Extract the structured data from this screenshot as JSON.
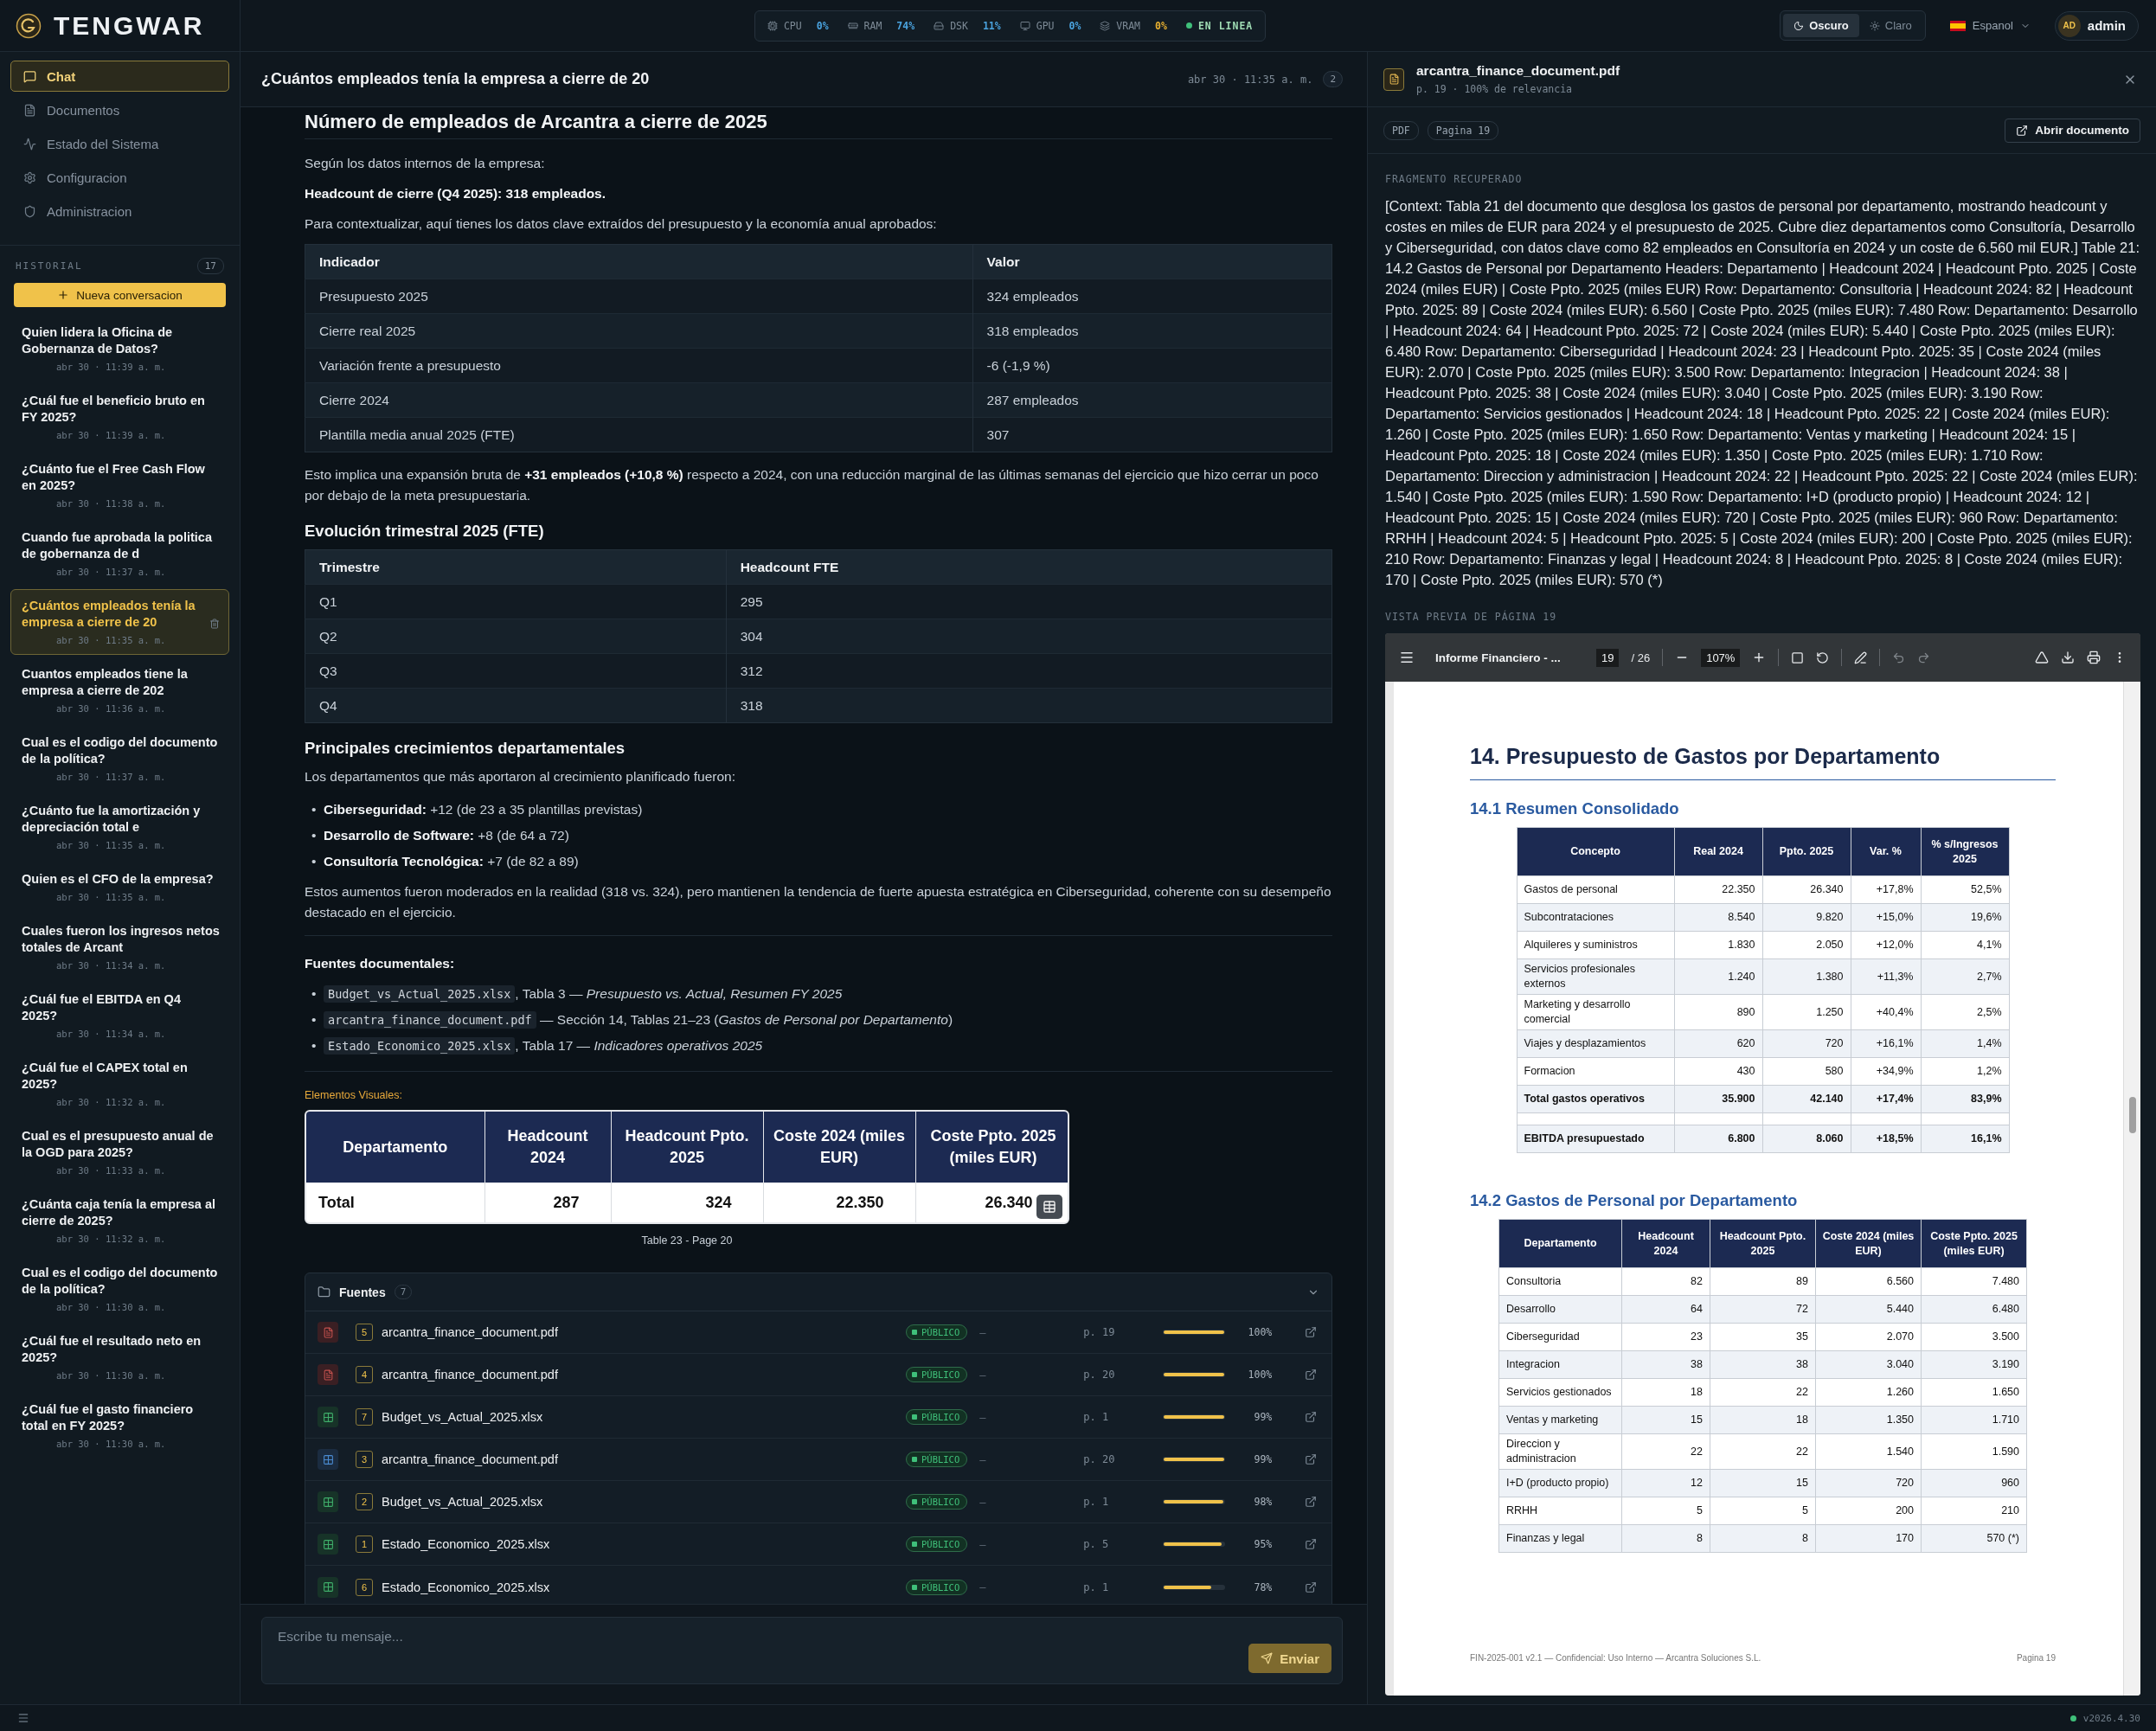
{
  "app": {
    "name": "TENGWAR"
  },
  "system_status": {
    "metrics": [
      {
        "kind": "cpu",
        "label": "CPU",
        "value": "0%",
        "color": "#4aa3df"
      },
      {
        "kind": "ram",
        "label": "RAM",
        "value": "74%",
        "color": "#4aa3df"
      },
      {
        "kind": "disk",
        "label": "DSK",
        "value": "11%",
        "color": "#4aa3df"
      },
      {
        "kind": "gpu",
        "label": "GPU",
        "value": "0%",
        "color": "#4aa3df"
      },
      {
        "kind": "vram",
        "label": "VRAM",
        "value": "0%",
        "color": "#e8b030"
      }
    ],
    "status": "EN LINEA"
  },
  "header_controls": {
    "themes": [
      {
        "kind": "dark",
        "label": "Oscuro",
        "selected": true
      },
      {
        "kind": "light",
        "label": "Claro",
        "selected": false
      }
    ],
    "language": "Espanol",
    "user": {
      "initials": "AD",
      "name": "admin"
    }
  },
  "sidebar": {
    "nav": [
      {
        "kind": "chat",
        "label": "Chat",
        "selected": true
      },
      {
        "kind": "docs",
        "label": "Documentos",
        "selected": false
      },
      {
        "kind": "status",
        "label": "Estado del Sistema",
        "selected": false
      },
      {
        "kind": "config",
        "label": "Configuracion",
        "selected": false
      },
      {
        "kind": "admin",
        "label": "Administracion",
        "selected": false
      }
    ],
    "history_label": "HISTORIAL",
    "history_count": "17",
    "new_button": "Nueva conversacion",
    "history": [
      {
        "title": "Quien lidera la Oficina de Gobernanza de Datos?",
        "time": "abr 30 · 11:39 a. m.",
        "selected": false
      },
      {
        "title": "¿Cuál fue el beneficio bruto en FY 2025?",
        "time": "abr 30 · 11:39 a. m.",
        "selected": false
      },
      {
        "title": "¿Cuánto fue el Free Cash Flow en 2025?",
        "time": "abr 30 · 11:38 a. m.",
        "selected": false
      },
      {
        "title": "Cuando fue aprobada la politica de gobernanza de d",
        "time": "abr 30 · 11:37 a. m.",
        "selected": false
      },
      {
        "title": "¿Cuántos empleados tenía la empresa a cierre de 20",
        "time": "abr 30 · 11:35 a. m.",
        "selected": true
      },
      {
        "title": "Cuantos empleados tiene la empresa a cierre de 202",
        "time": "abr 30 · 11:36 a. m.",
        "selected": false
      },
      {
        "title": "Cual es el codigo del documento de la política?",
        "time": "abr 30 · 11:37 a. m.",
        "selected": false
      },
      {
        "title": "¿Cuánto fue la amortización y depreciación total e",
        "time": "abr 30 · 11:35 a. m.",
        "selected": false
      },
      {
        "title": "Quien es el CFO de la empresa?",
        "time": "abr 30 · 11:35 a. m.",
        "selected": false
      },
      {
        "title": "Cuales fueron los ingresos netos totales de Arcant",
        "time": "abr 30 · 11:34 a. m.",
        "selected": false
      },
      {
        "title": "¿Cuál fue el EBITDA en Q4 2025?",
        "time": "abr 30 · 11:34 a. m.",
        "selected": false
      },
      {
        "title": "¿Cuál fue el CAPEX total en 2025?",
        "time": "abr 30 · 11:32 a. m.",
        "selected": false
      },
      {
        "title": "Cual es el presupuesto anual de la OGD para 2025?",
        "time": "abr 30 · 11:33 a. m.",
        "selected": false
      },
      {
        "title": "¿Cuánta caja tenía la empresa al cierre de 2025?",
        "time": "abr 30 · 11:32 a. m.",
        "selected": false
      },
      {
        "title": "Cual es el codigo del documento de la política?",
        "time": "abr 30 · 11:30 a. m.",
        "selected": false
      },
      {
        "title": "¿Cuál fue el resultado neto en 2025?",
        "time": "abr 30 · 11:30 a. m.",
        "selected": false
      },
      {
        "title": "¿Cuál fue el gasto financiero total en FY 2025?",
        "time": "abr 30 · 11:30 a. m.",
        "selected": false
      }
    ]
  },
  "chat": {
    "title": "¿Cuántos empleados tenía la empresa a cierre de 20",
    "time": "abr 30 · 11:35 a. m.",
    "badge": "2",
    "blocks": [
      {
        "kind": "heading",
        "text": "Número de empleados de Arcantra a cierre de 2025"
      },
      {
        "kind": "paragraph",
        "text": "Según los datos internos de la empresa:"
      },
      {
        "kind": "strong",
        "text": "Headcount de cierre (Q4 2025): 318 empleados."
      },
      {
        "kind": "paragraph",
        "text": "Para contextualizar, aquí tienes los datos clave extraídos del presupuesto y la economía anual aprobados:"
      },
      {
        "kind": "table",
        "columns": [
          "Indicador",
          "Valor"
        ],
        "rows": [
          [
            "Presupuesto 2025",
            "324 empleados"
          ],
          [
            "Cierre real 2025",
            "318 empleados"
          ],
          [
            "Variación frente a presupuesto",
            "-6 (-1,9 %)"
          ],
          [
            "Cierre 2024",
            "287 empleados"
          ],
          [
            "Plantilla media anual 2025 (FTE)",
            "307"
          ]
        ]
      },
      {
        "kind": "paragraph",
        "text": "Esto implica una expansión bruta de **+31 empleados (+10,8 %)** respecto a 2024, con una reducción marginal de las últimas semanas del ejercicio que hizo cerrar un poco por debajo de la meta presupuestaria."
      },
      {
        "kind": "subheading",
        "text": "Evolución trimestral 2025 (FTE)"
      },
      {
        "kind": "table",
        "columns": [
          "Trimestre",
          "Headcount FTE"
        ],
        "rows": [
          [
            "Q1",
            "295"
          ],
          [
            "Q2",
            "304"
          ],
          [
            "Q3",
            "312"
          ],
          [
            "Q4",
            "318"
          ]
        ]
      },
      {
        "kind": "subheading",
        "text": "Principales crecimientos departamentales"
      },
      {
        "kind": "paragraph",
        "text": "Los departamentos que más aportaron al crecimiento planificado fueron:"
      },
      {
        "kind": "list",
        "bullet": "•",
        "items": [
          "**Ciberseguridad:** +12 (de 23 a 35 plantillas previstas)",
          "**Desarrollo de Software:** +8 (de 64 a 72)",
          "**Consultoría Tecnológica:** +7 (de 82 a 89)"
        ]
      },
      {
        "kind": "paragraph",
        "text": "Estos aumentos fueron moderados en la realidad (318 vs. 324), pero mantienen la tendencia de fuerte apuesta estratégica en Ciberseguridad, coherente con su desempeño destacado en el ejercicio."
      },
      {
        "kind": "rule"
      },
      {
        "kind": "label",
        "text": "Fuentes documentales:"
      },
      {
        "kind": "references",
        "bullet": "•",
        "items": [
          {
            "code": "Budget_vs_Actual_2025.xlsx",
            "text": ", Tabla 3 — *Presupuesto vs. Actual, Resumen FY 2025*"
          },
          {
            "code": "arcantra_finance_document.pdf",
            "text": " — Sección 14, Tablas 21–23 (*Gastos de Personal por Departamento*)"
          },
          {
            "code": "Estado_Economico_2025.xlsx",
            "text": ", Tabla 17 — *Indicadores operativos 2025*"
          }
        ]
      },
      {
        "kind": "rule"
      },
      {
        "kind": "visual",
        "label": "Elementos Visuales:",
        "columns": [
          "Departamento",
          "Headcount 2024",
          "Headcount Ppto. 2025",
          "Coste 2024 (miles EUR)",
          "Coste Ppto. 2025 (miles EUR)"
        ],
        "rows": [
          [
            "Total",
            "287",
            "324",
            "22.350",
            "26.340"
          ]
        ],
        "caption": "Table 23 - Page 20"
      }
    ],
    "sources": {
      "title": "Fuentes",
      "count": "7",
      "items": [
        {
          "kind": "pdf",
          "index": "5",
          "name": "arcantra_finance_document.pdf",
          "access": "PÚBLICO",
          "detail": "–",
          "page": "p. 19",
          "level": 1,
          "score": "100%"
        },
        {
          "kind": "pdf",
          "index": "4",
          "name": "arcantra_finance_document.pdf",
          "access": "PÚBLICO",
          "detail": "–",
          "page": "p. 20",
          "level": 1,
          "score": "100%"
        },
        {
          "kind": "sheet",
          "index": "7",
          "name": "Budget_vs_Actual_2025.xlsx",
          "access": "PÚBLICO",
          "detail": "–",
          "page": "p. 1",
          "level": 0.99,
          "score": "99%"
        },
        {
          "kind": "table",
          "index": "3",
          "name": "arcantra_finance_document.pdf",
          "access": "PÚBLICO",
          "detail": "–",
          "page": "p. 20",
          "level": 0.99,
          "score": "99%"
        },
        {
          "kind": "sheet",
          "index": "2",
          "name": "Budget_vs_Actual_2025.xlsx",
          "access": "PÚBLICO",
          "detail": "–",
          "page": "p. 1",
          "level": 0.98,
          "score": "98%"
        },
        {
          "kind": "sheet",
          "index": "1",
          "name": "Estado_Economico_2025.xlsx",
          "access": "PÚBLICO",
          "detail": "–",
          "page": "p. 5",
          "level": 0.95,
          "score": "95%"
        },
        {
          "kind": "sheet",
          "index": "6",
          "name": "Estado_Economico_2025.xlsx",
          "access": "PÚBLICO",
          "detail": "–",
          "page": "p. 1",
          "level": 0.78,
          "score": "78%"
        }
      ]
    },
    "input": {
      "placeholder": "Escribe tu mensaje...",
      "send": "Enviar"
    }
  },
  "detail": {
    "file": "arcantra_finance_document.pdf",
    "meta": "p. 19 · 100% de relevancia",
    "tags": [
      "PDF",
      "Pagina 19"
    ],
    "open_button": "Abrir documento",
    "fragment_label": "FRAGMENTO RECUPERADO",
    "fragment": "[Context: Tabla 21 del documento que desglosa los gastos de personal por departamento, mostrando headcount y costes en miles de EUR para 2024 y el presupuesto de 2025. Cubre diez departamentos como Consultoría, Desarrollo y Ciberseguridad, con datos clave como 82 empleados en Consultoría en 2024 y un coste de 6.560 mil EUR.] Table 21: 14.2 Gastos de Personal por Departamento Headers: Departamento | Headcount 2024 | Headcount Ppto. 2025 | Coste 2024 (miles EUR) | Coste Ppto. 2025 (miles EUR) Row: Departamento: Consultoria | Headcount 2024: 82 | Headcount Ppto. 2025: 89 | Coste 2024 (miles EUR): 6.560 | Coste Ppto. 2025 (miles EUR): 7.480 Row: Departamento: Desarrollo | Headcount 2024: 64 | Headcount Ppto. 2025: 72 | Coste 2024 (miles EUR): 5.440 | Coste Ppto. 2025 (miles EUR): 6.480 Row: Departamento: Ciberseguridad | Headcount 2024: 23 | Headcount Ppto. 2025: 35 | Coste 2024 (miles EUR): 2.070 | Coste Ppto. 2025 (miles EUR): 3.500 Row: Departamento: Integracion | Headcount 2024: 38 | Headcount Ppto. 2025: 38 | Coste 2024 (miles EUR): 3.040 | Coste Ppto. 2025 (miles EUR): 3.190 Row: Departamento: Servicios gestionados | Headcount 2024: 18 | Headcount Ppto. 2025: 22 | Coste 2024 (miles EUR): 1.260 | Coste Ppto. 2025 (miles EUR): 1.650 Row: Departamento: Ventas y marketing | Headcount 2024: 15 | Headcount Ppto. 2025: 18 | Coste 2024 (miles EUR): 1.350 | Coste Ppto. 2025 (miles EUR): 1.710 Row: Departamento: Direccion y administracion | Headcount 2024: 22 | Headcount Ppto. 2025: 22 | Coste 2024 (miles EUR): 1.540 | Coste Ppto. 2025 (miles EUR): 1.590 Row: Departamento: I+D (producto propio) | Headcount 2024: 12 | Headcount Ppto. 2025: 15 | Coste 2024 (miles EUR): 720 | Coste Ppto. 2025 (miles EUR): 960 Row: Departamento: RRHH | Headcount 2024: 5 | Headcount Ppto. 2025: 5 | Coste 2024 (miles EUR): 200 | Coste Ppto. 2025 (miles EUR): 210 Row: Departamento: Finanzas y legal | Headcount 2024: 8 | Headcount Ppto. 2025: 8 | Coste 2024 (miles EUR): 170 | Coste Ppto. 2025 (miles EUR): 570 (*)",
    "preview_label": "VISTA PREVIA DE PÁGINA 19",
    "viewer": {
      "title": "Informe Financiero - ...",
      "page": "19",
      "total": "/ 26",
      "zoom": "107%",
      "page_content": {
        "title": "14. Presupuesto de Gastos por Departamento",
        "sections": [
          {
            "heading": "14.1 Resumen Consolidado",
            "columns": [
              "Concepto",
              "Real 2024",
              "Ppto. 2025",
              "Var. %",
              "% s/Ingresos 2025"
            ],
            "rows": [
              {
                "kind": "normal",
                "cells": [
                  "Gastos de personal",
                  "22.350",
                  "26.340",
                  "+17,8%",
                  "52,5%"
                ]
              },
              {
                "kind": "normal",
                "cells": [
                  "Subcontrataciones",
                  "8.540",
                  "9.820",
                  "+15,0%",
                  "19,6%"
                ]
              },
              {
                "kind": "normal",
                "cells": [
                  "Alquileres y suministros",
                  "1.830",
                  "2.050",
                  "+12,0%",
                  "4,1%"
                ]
              },
              {
                "kind": "normal",
                "cells": [
                  "Servicios profesionales externos",
                  "1.240",
                  "1.380",
                  "+11,3%",
                  "2,7%"
                ]
              },
              {
                "kind": "normal",
                "cells": [
                  "Marketing y desarrollo comercial",
                  "890",
                  "1.250",
                  "+40,4%",
                  "2,5%"
                ]
              },
              {
                "kind": "normal",
                "cells": [
                  "Viajes y desplazamientos",
                  "620",
                  "720",
                  "+16,1%",
                  "1,4%"
                ]
              },
              {
                "kind": "normal",
                "cells": [
                  "Formacion",
                  "430",
                  "580",
                  "+34,9%",
                  "1,2%"
                ]
              },
              {
                "kind": "total",
                "cells": [
                  "Total gastos operativos",
                  "35.900",
                  "42.140",
                  "+17,4%",
                  "83,9%"
                ]
              },
              {
                "kind": "spacer"
              },
              {
                "kind": "total",
                "cells": [
                  "EBITDA presupuestado",
                  "6.800",
                  "8.060",
                  "+18,5%",
                  "16,1%"
                ]
              }
            ]
          },
          {
            "heading": "14.2 Gastos de Personal por Departamento",
            "columns": [
              "Departamento",
              "Headcount 2024",
              "Headcount Ppto. 2025",
              "Coste 2024 (miles EUR)",
              "Coste Ppto. 2025 (miles EUR)"
            ],
            "rows": [
              {
                "kind": "normal",
                "cells": [
                  "Consultoria",
                  "82",
                  "89",
                  "6.560",
                  "7.480"
                ]
              },
              {
                "kind": "normal",
                "cells": [
                  "Desarrollo",
                  "64",
                  "72",
                  "5.440",
                  "6.480"
                ]
              },
              {
                "kind": "normal",
                "cells": [
                  "Ciberseguridad",
                  "23",
                  "35",
                  "2.070",
                  "3.500"
                ]
              },
              {
                "kind": "normal",
                "cells": [
                  "Integracion",
                  "38",
                  "38",
                  "3.040",
                  "3.190"
                ]
              },
              {
                "kind": "normal",
                "cells": [
                  "Servicios gestionados",
                  "18",
                  "22",
                  "1.260",
                  "1.650"
                ]
              },
              {
                "kind": "normal",
                "cells": [
                  "Ventas y marketing",
                  "15",
                  "18",
                  "1.350",
                  "1.710"
                ]
              },
              {
                "kind": "normal",
                "cells": [
                  "Direccion y administracion",
                  "22",
                  "22",
                  "1.540",
                  "1.590"
                ]
              },
              {
                "kind": "normal",
                "cells": [
                  "I+D (producto propio)",
                  "12",
                  "15",
                  "720",
                  "960"
                ]
              },
              {
                "kind": "normal",
                "cells": [
                  "RRHH",
                  "5",
                  "5",
                  "200",
                  "210"
                ]
              },
              {
                "kind": "normal",
                "cells": [
                  "Finanzas y legal",
                  "8",
                  "8",
                  "170",
                  "570 (*)"
                ]
              }
            ]
          }
        ],
        "footer_left": "FIN-2025-001 v2.1 — Confidencial: Uso Interno — Arcantra Soluciones S.L.",
        "footer_right": "Pagina 19"
      }
    }
  },
  "footer": {
    "version": "v2026.4.30"
  }
}
